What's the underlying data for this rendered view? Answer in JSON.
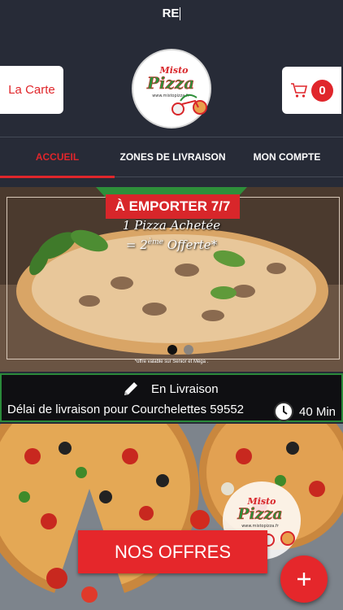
{
  "search": {
    "text": "RE"
  },
  "header": {
    "menu_label": "La Carte",
    "logo_title": "Misto",
    "logo_brand": "Pizza",
    "logo_url": "www.mistopizza.fr",
    "cart_count": "0"
  },
  "nav": {
    "tabs": [
      {
        "label": "ACCUEIL"
      },
      {
        "label": "ZONES DE LIVRAISON"
      },
      {
        "label": "MON COMPTE"
      }
    ]
  },
  "banner": {
    "ribbon": "À EMPORTER 7/7",
    "line1": "1 Pizza Achetée",
    "line2_prefix": "= 2",
    "line2_sup": "ème",
    "line2_suffix": " Offerte*",
    "footnote": "*offre valable sur Senior et Méga ."
  },
  "delivery": {
    "mode": "En Livraison",
    "label": "Délai de livraison pour Courchelettes 59552",
    "time": "40 Min"
  },
  "offers": {
    "button": "NOS OFFRES"
  },
  "colors": {
    "accent": "#e0262b",
    "background": "#272b37",
    "green": "#2a8a3a"
  },
  "icons": [
    "cart-icon",
    "pencil-icon",
    "clock-icon",
    "plus-icon"
  ]
}
